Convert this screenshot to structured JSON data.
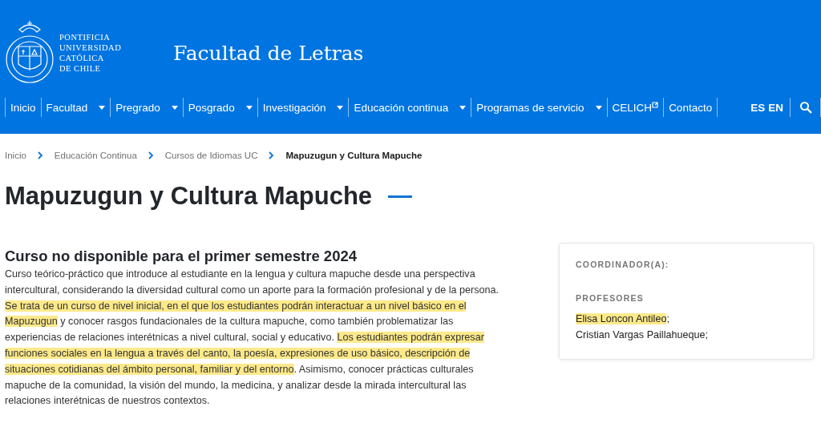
{
  "header": {
    "logo_lines": [
      "PONTIFICIA",
      "UNIVERSIDAD",
      "CATÓLICA",
      "DE CHILE"
    ],
    "site_title": "Facultad de Letras"
  },
  "nav": {
    "items": [
      {
        "label": "Inicio",
        "dropdown": false,
        "external": false
      },
      {
        "label": "Facultad",
        "dropdown": true,
        "external": false
      },
      {
        "label": "Pregrado",
        "dropdown": true,
        "external": false
      },
      {
        "label": "Posgrado",
        "dropdown": true,
        "external": false
      },
      {
        "label": "Investigación",
        "dropdown": true,
        "external": false
      },
      {
        "label": "Educación continua",
        "dropdown": true,
        "external": false
      },
      {
        "label": "Programas de servicio",
        "dropdown": true,
        "external": false
      },
      {
        "label": "CELICH",
        "dropdown": false,
        "external": true
      },
      {
        "label": "Contacto",
        "dropdown": false,
        "external": false
      }
    ],
    "languages": [
      "ES",
      "EN"
    ]
  },
  "breadcrumb": [
    {
      "label": "Inicio",
      "current": false
    },
    {
      "label": "Educación Continua",
      "current": false
    },
    {
      "label": "Cursos de Idiomas UC",
      "current": false
    },
    {
      "label": "Mapuzugun y Cultura Mapuche",
      "current": true
    }
  ],
  "page_title": "Mapuzugun y Cultura Mapuche",
  "section_heading": "Curso no disponible para el primer semestre 2024",
  "description": [
    {
      "text": "Curso teórico-práctico que introduce al estudiante en la lengua y cultura mapuche desde una perspectiva intercultural, considerando la diversidad cultural como un aporte para la formación profesional y de la persona. ",
      "highlighted": false
    },
    {
      "text": "Se trata de un curso de nivel inicial, en el que los estudiantes podrán interactuar a un nivel básico en el Mapuzugun",
      "highlighted": true
    },
    {
      "text": " y conocer rasgos fundacionales de la cultura mapuche, como también problematizar las experiencias de relaciones interétnicas a nivel cultural, social y educativo. ",
      "highlighted": false
    },
    {
      "text": "Los estudiantes podrán expresar funciones sociales en la lengua a través del canto, la poesía, expresiones de uso básico, descripción de situaciones cotidianas del ámbito personal, familiar y del entorno",
      "highlighted": true
    },
    {
      "text": ". Asimismo, conocer prácticas culturales mapuche de la comunidad, la visión del mundo, la medicina, y analizar desde la mirada intercultural las relaciones interétnicas de nuestros contextos.",
      "highlighted": false
    }
  ],
  "sidebar": {
    "coordinator_label": "COORDINADOR(A):",
    "professors_label": "PROFESORES",
    "professors": [
      [
        {
          "text": "Elisa Loncon Antileo",
          "highlighted": true
        },
        {
          "text": ";",
          "highlighted": false
        }
      ],
      [
        {
          "text": "Cristian Vargas Paillahueque;",
          "highlighted": false
        }
      ]
    ]
  }
}
